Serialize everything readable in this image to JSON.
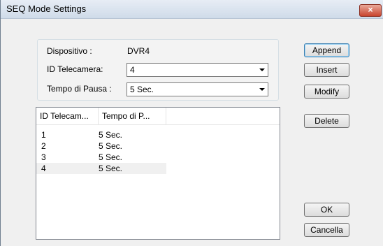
{
  "window": {
    "title": "SEQ Mode Settings",
    "close_glyph": "×"
  },
  "form": {
    "device_label": "Dispositivo :",
    "device_value": "DVR4",
    "camera_label": "ID Telecamera:",
    "camera_value": "4",
    "pause_label": "Tempo di Pausa :",
    "pause_value": "5 Sec."
  },
  "buttons": {
    "append": "Append",
    "insert": "Insert",
    "modify": "Modify",
    "delete": "Delete",
    "ok": "OK",
    "cancel": "Cancella"
  },
  "table": {
    "columns": [
      "ID Telecam...",
      "Tempo di P..."
    ],
    "rows": [
      {
        "id": "1",
        "pause": "5 Sec."
      },
      {
        "id": "2",
        "pause": "5 Sec."
      },
      {
        "id": "3",
        "pause": "5 Sec."
      },
      {
        "id": "4",
        "pause": "5 Sec."
      }
    ]
  },
  "icons": {
    "close": "close-icon",
    "dropdown": "chevron-down-icon"
  }
}
